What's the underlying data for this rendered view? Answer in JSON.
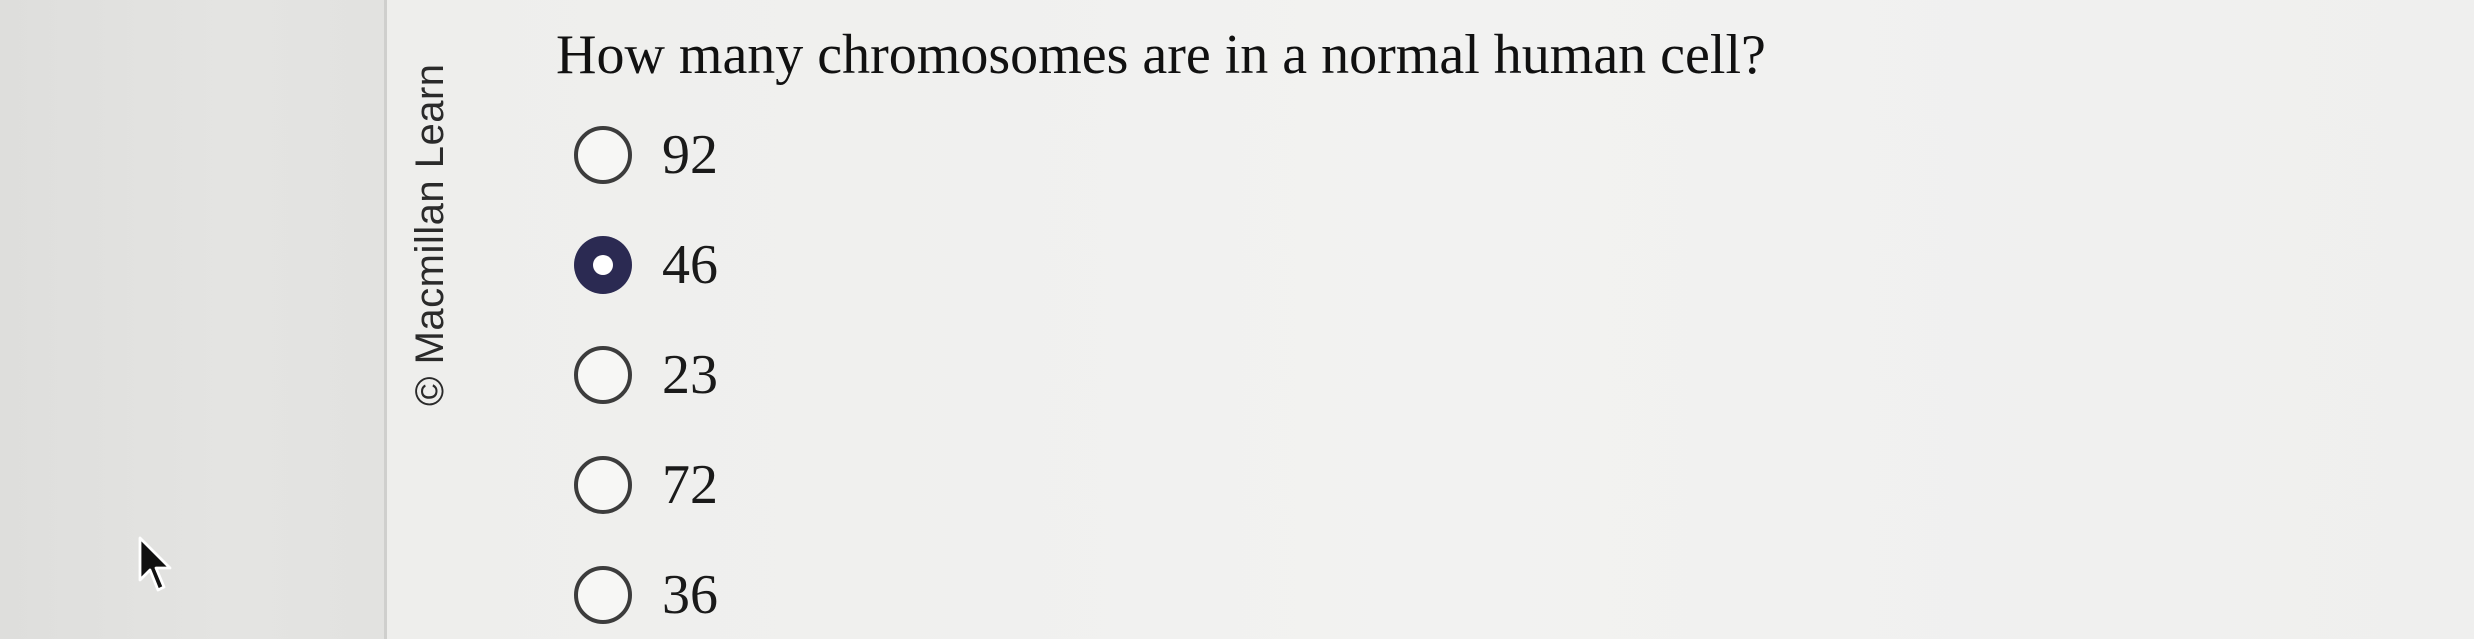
{
  "copyright": "© Macmillan Learn",
  "question": {
    "text": "How many chromosomes are in a normal human cell?"
  },
  "options": [
    {
      "label": "92",
      "selected": false
    },
    {
      "label": "46",
      "selected": true
    },
    {
      "label": "23",
      "selected": false
    },
    {
      "label": "72",
      "selected": false
    },
    {
      "label": "36",
      "selected": false
    }
  ],
  "colors": {
    "selected_radio": "#2b2a52",
    "text": "#111111"
  }
}
